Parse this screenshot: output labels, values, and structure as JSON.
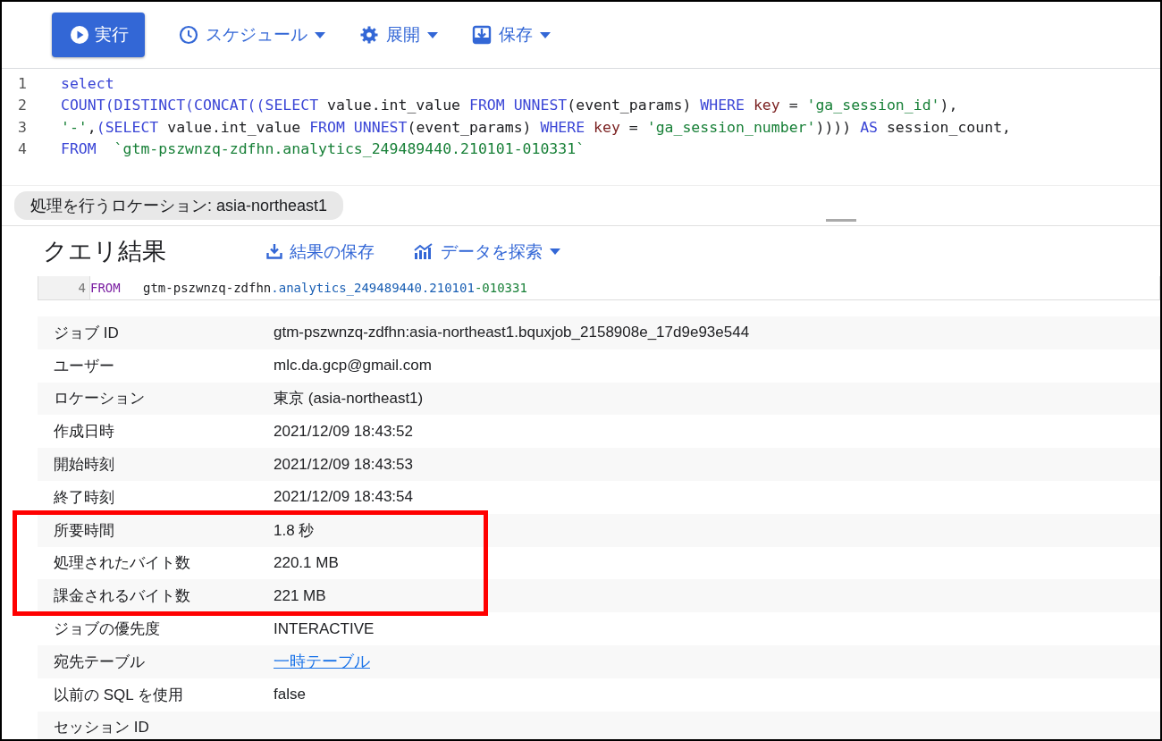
{
  "toolbar": {
    "buttons": [
      {
        "kind": "run",
        "label": "実行"
      },
      {
        "kind": "schedule",
        "label": "スケジュール"
      },
      {
        "kind": "deploy",
        "label": "展開"
      },
      {
        "kind": "save",
        "label": "保存"
      }
    ]
  },
  "editor": {
    "lines": [
      {
        "number": "1",
        "tokens": [
          {
            "kind": "kw",
            "text": "select"
          }
        ]
      },
      {
        "number": "2",
        "tokens": [
          {
            "kind": "kw",
            "text": "COUNT(DISTINCT(CONCAT((SELECT"
          },
          {
            "kind": "plain",
            "text": " value.int_value "
          },
          {
            "kind": "kw",
            "text": "FROM UNNEST"
          },
          {
            "kind": "plain",
            "text": "(event_params) "
          },
          {
            "kind": "kw",
            "text": "WHERE"
          },
          {
            "kind": "ident",
            "text": " key "
          },
          {
            "kind": "plain",
            "text": "= "
          },
          {
            "kind": "str",
            "text": "'ga_session_id'"
          },
          {
            "kind": "plain",
            "text": "),"
          }
        ]
      },
      {
        "number": "3",
        "tokens": [
          {
            "kind": "str",
            "text": "'-'"
          },
          {
            "kind": "plain",
            "text": ","
          },
          {
            "kind": "kw",
            "text": "(SELECT"
          },
          {
            "kind": "plain",
            "text": " value.int_value "
          },
          {
            "kind": "kw",
            "text": "FROM UNNEST"
          },
          {
            "kind": "plain",
            "text": "(event_params) "
          },
          {
            "kind": "kw",
            "text": "WHERE"
          },
          {
            "kind": "ident",
            "text": " key "
          },
          {
            "kind": "plain",
            "text": "= "
          },
          {
            "kind": "str",
            "text": "'ga_session_number'"
          },
          {
            "kind": "plain",
            "text": ")))) "
          },
          {
            "kind": "kw",
            "text": "AS"
          },
          {
            "kind": "plain",
            "text": " session_count,"
          }
        ]
      },
      {
        "number": "4",
        "tokens": [
          {
            "kind": "kw",
            "text": "FROM"
          },
          {
            "kind": "str",
            "text": "`gtm-pszwnzq-zdfhn.analytics_249489440.210101-010331`",
            "gap": true
          }
        ]
      }
    ]
  },
  "location_chip": "処理を行うロケーション: asia-northeast1",
  "results": {
    "title": "クエリ結果",
    "actions": [
      {
        "kind": "save",
        "label": "結果の保存"
      },
      {
        "kind": "explore",
        "label": "データを探索"
      }
    ],
    "snippet": {
      "number": "4",
      "tokens": [
        {
          "kind": "kw",
          "text": "FROM"
        },
        {
          "kind": "plain",
          "text": "gtm-pszwnzq-zdfhn",
          "gap": true
        },
        {
          "kind": "table",
          "text": ".analytics_249489440.210101"
        },
        {
          "kind": "str",
          "text": "-010331"
        }
      ]
    },
    "sections": [
      {
        "highlighted": false,
        "rows": [
          {
            "label": "ジョブ ID",
            "value": "gtm-pszwnzq-zdfhn:asia-northeast1.bquxjob_2158908e_17d9e93e544",
            "kind": "text"
          },
          {
            "label": "ユーザー",
            "value": "mlc.da.gcp@gmail.com",
            "kind": "text"
          },
          {
            "label": "ロケーション",
            "value": "東京 (asia-northeast1)",
            "kind": "text"
          },
          {
            "label": "作成日時",
            "value": "2021/12/09 18:43:52",
            "kind": "text"
          },
          {
            "label": "開始時刻",
            "value": "2021/12/09 18:43:53",
            "kind": "text"
          },
          {
            "label": "終了時刻",
            "value": "2021/12/09 18:43:54",
            "kind": "text"
          }
        ]
      },
      {
        "highlighted": true,
        "rows": [
          {
            "label": "所要時間",
            "value": "1.8 秒",
            "kind": "text"
          },
          {
            "label": "処理されたバイト数",
            "value": "220.1 MB",
            "kind": "text"
          },
          {
            "label": "課金されるバイト数",
            "value": "221 MB",
            "kind": "text"
          }
        ]
      },
      {
        "highlighted": false,
        "rows": [
          {
            "label": "ジョブの優先度",
            "value": "INTERACTIVE",
            "kind": "text"
          },
          {
            "label": "宛先テーブル",
            "value": "一時テーブル",
            "kind": "link"
          },
          {
            "label": "以前の SQL を使用",
            "value": "false",
            "kind": "text"
          },
          {
            "label": "セッション ID",
            "kind": "text"
          }
        ]
      }
    ]
  }
}
